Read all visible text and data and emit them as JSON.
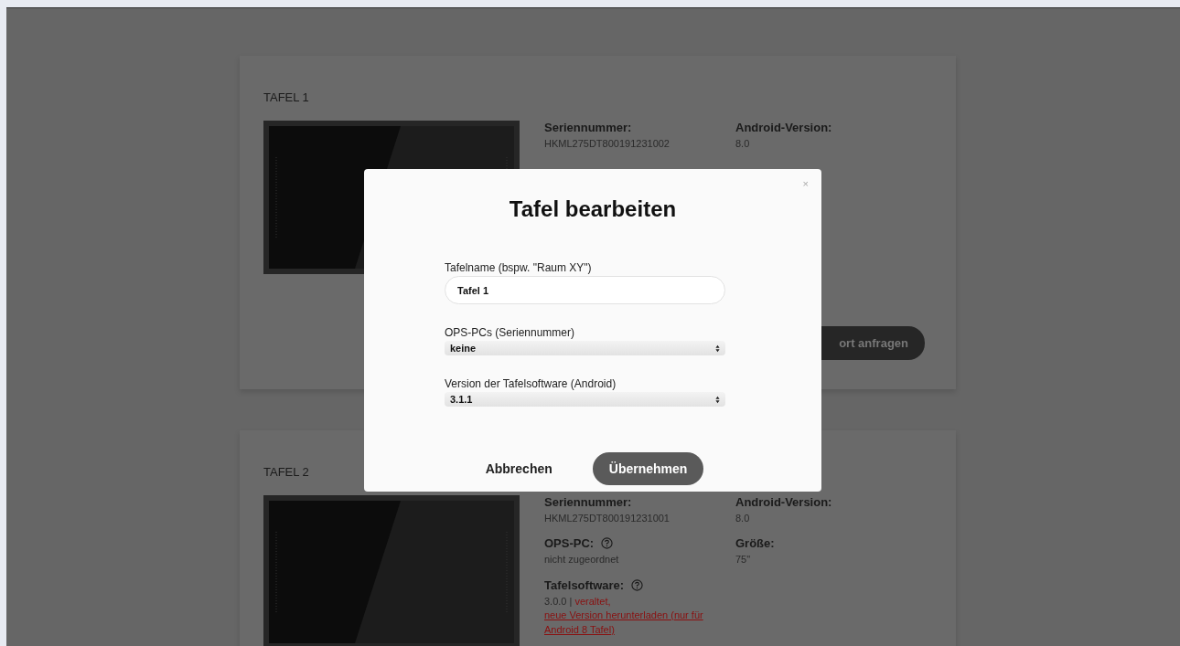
{
  "boards": [
    {
      "title": "TAFEL 1",
      "details": [
        {
          "label": "Seriennummer:",
          "value": "HKML275DT800191231002"
        },
        {
          "label": "Android-Version:",
          "value": "8.0"
        }
      ],
      "action_button": "ort anfragen"
    },
    {
      "title": "TAFEL 2",
      "details": [
        {
          "label": "Seriennummer:",
          "value": "HKML275DT800191231001"
        },
        {
          "label": "Android-Version:",
          "value": "8.0"
        },
        {
          "label": "OPS-PC:",
          "value": "nicht zugeordnet",
          "help": true
        },
        {
          "label": "Größe:",
          "value": "75\""
        },
        {
          "label": "Tafelsoftware:",
          "value": "3.0.0 | ",
          "warning": "veraltet,",
          "link": "neue Version herunterladen (nur für Android 8 Tafel)",
          "help": true
        }
      ]
    }
  ],
  "dialog": {
    "close": "×",
    "title": "Tafel bearbeiten",
    "fields": [
      {
        "kind": "input",
        "label": "Tafelname (bspw. \"Raum XY\")",
        "value": "Tafel 1"
      },
      {
        "kind": "select",
        "label": "OPS-PCs (Seriennummer)",
        "value": "keine"
      },
      {
        "kind": "select",
        "label": "Version der Tafelsoftware (Android)",
        "value": "3.1.1"
      }
    ],
    "cancel_button": "Abbrechen",
    "confirm_button": "Übernehmen"
  }
}
